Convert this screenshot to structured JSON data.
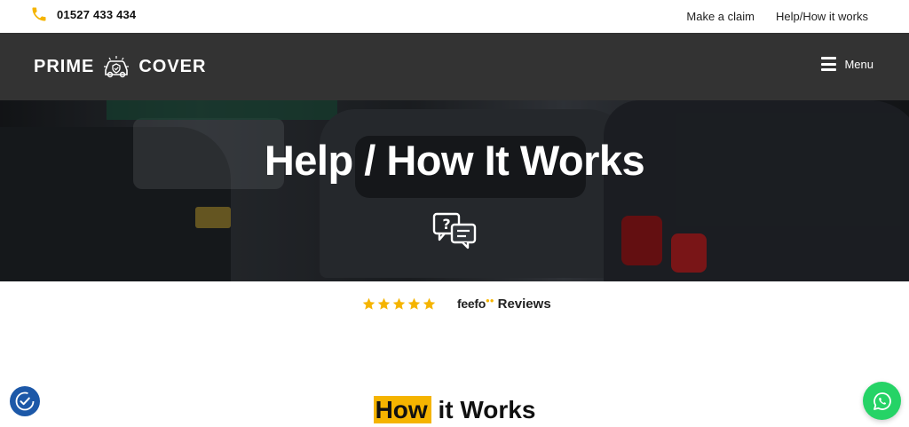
{
  "topbar": {
    "phone": "01527 433 434",
    "phone_icon": "phone-icon",
    "links": [
      "Make a claim",
      "Help/How it works"
    ]
  },
  "header": {
    "logo_left": "PRIME",
    "logo_right": "COVER",
    "logo_icon": "car-shield-icon",
    "menu_label": "Menu",
    "menu_icon": "hamburger-icon"
  },
  "hero": {
    "title": "Help / How It Works",
    "icon": "chat-question-icon"
  },
  "reviews": {
    "stars": 5,
    "brand": "feefo",
    "label": "Reviews"
  },
  "section": {
    "title_highlight": "How",
    "title_rest": " it Works"
  },
  "floating": {
    "accessibility_icon": "accessibility-icon",
    "whatsapp_icon": "whatsapp-icon"
  },
  "colors": {
    "accent": "#f5b400",
    "header_bg": "#333333",
    "whatsapp": "#25d366",
    "accessibility": "#1c58a8"
  }
}
